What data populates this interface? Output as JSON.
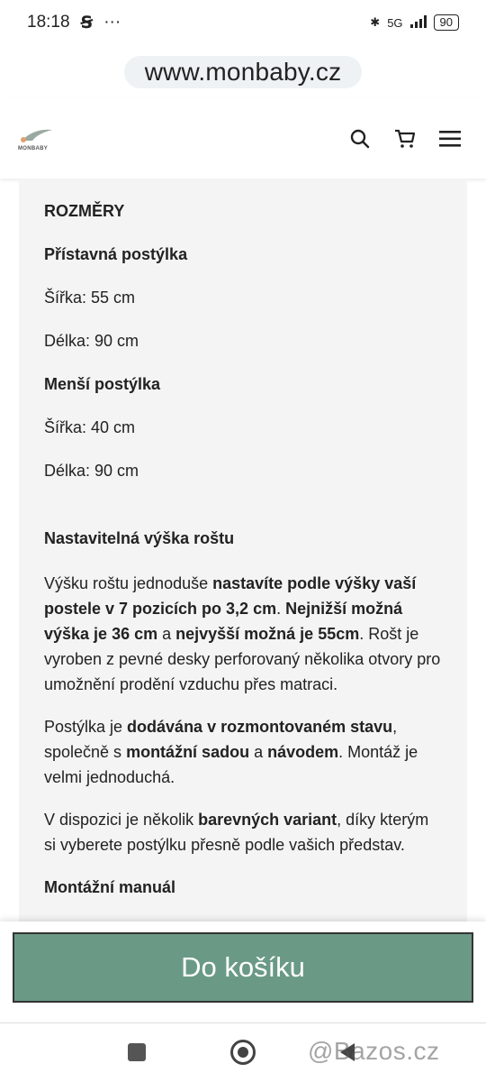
{
  "status_bar": {
    "time": "18:18",
    "network": "5G",
    "battery": "90",
    "app_icon": "s-icon",
    "more": "···"
  },
  "browser": {
    "url": "www.monbaby.cz"
  },
  "header": {
    "logo_text": "MONBABY",
    "icons": [
      "search-icon",
      "cart-icon",
      "menu-icon"
    ]
  },
  "content": {
    "section_title": "ROZMĚRY",
    "crib1": {
      "title": "Přístavná postýlka",
      "width": "Šířka: 55 cm",
      "length": "Délka: 90 cm"
    },
    "crib2": {
      "title": "Menší postýlka",
      "width": "Šířka: 40 cm",
      "length": "Délka: 90 cm"
    },
    "height_title": "Nastavitelná výška roštu",
    "para1": {
      "t1": "Výšku roštu jednoduše ",
      "b1": "nastavíte podle výšky vaší postele v 7 pozicích po 3,2 cm",
      "t2": ". ",
      "b2": "Nejnižší možná výška je 36 cm",
      "t3": " a ",
      "b3": "nejvyšší možná je 55cm",
      "t4": ". Rošt je vyroben z pevné desky perforovaný několika otvory pro umožnění prodění vzduchu přes matraci."
    },
    "para2": {
      "t1": "Postýlka je ",
      "b1": "dodávána v rozmontovaném stavu",
      "t2": ", společně s ",
      "b2": "montážní sadou",
      "t3": " a ",
      "b3": "návodem",
      "t4": ". Montáž je velmi jednoduchá."
    },
    "para3": {
      "t1": "V dispozici je několik ",
      "b1": "barevných variant",
      "t2": ", díky kterým si vyberete postýlku přesně podle vašich představ."
    },
    "manual_link": "Montážní manuál"
  },
  "cta": {
    "label": "Do košíku"
  },
  "watermark": "@Bazos.cz",
  "colors": {
    "accent": "#6a9a85",
    "link": "#c9a35a",
    "content_bg": "#f4f4f4"
  }
}
